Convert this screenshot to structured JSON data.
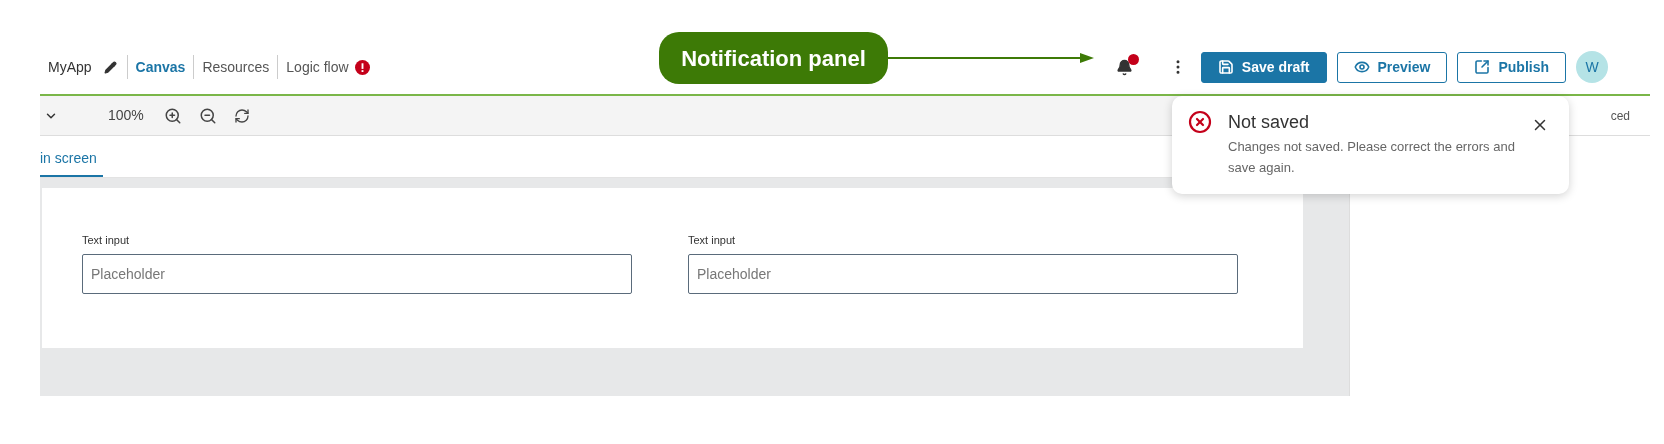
{
  "header": {
    "app_name": "MyApp",
    "tabs": [
      {
        "label": "Canvas",
        "selected": true,
        "error": false
      },
      {
        "label": "Resources",
        "selected": false,
        "error": false
      },
      {
        "label": "Logic flow",
        "selected": false,
        "error": true
      }
    ],
    "bell": {
      "unread": true
    },
    "buttons": [
      {
        "label": "Save draft",
        "kind": "primary"
      },
      {
        "label": "Preview",
        "kind": "preview"
      },
      {
        "label": "Publish",
        "kind": "publish"
      }
    ],
    "avatar": "W"
  },
  "annotation": {
    "label": "Notification panel"
  },
  "toolbar": {
    "zoom": "100%"
  },
  "right_panel": {
    "tab_3": "ced"
  },
  "screen_tab": {
    "label": "in screen",
    "selected": true
  },
  "form": {
    "fields": [
      {
        "label": "Text input",
        "placeholder": "Placeholder"
      },
      {
        "label": "Text input",
        "placeholder": "Placeholder"
      }
    ]
  },
  "notification": {
    "title": "Not saved",
    "message": "Changes not saved. Please correct the errors and save again."
  }
}
